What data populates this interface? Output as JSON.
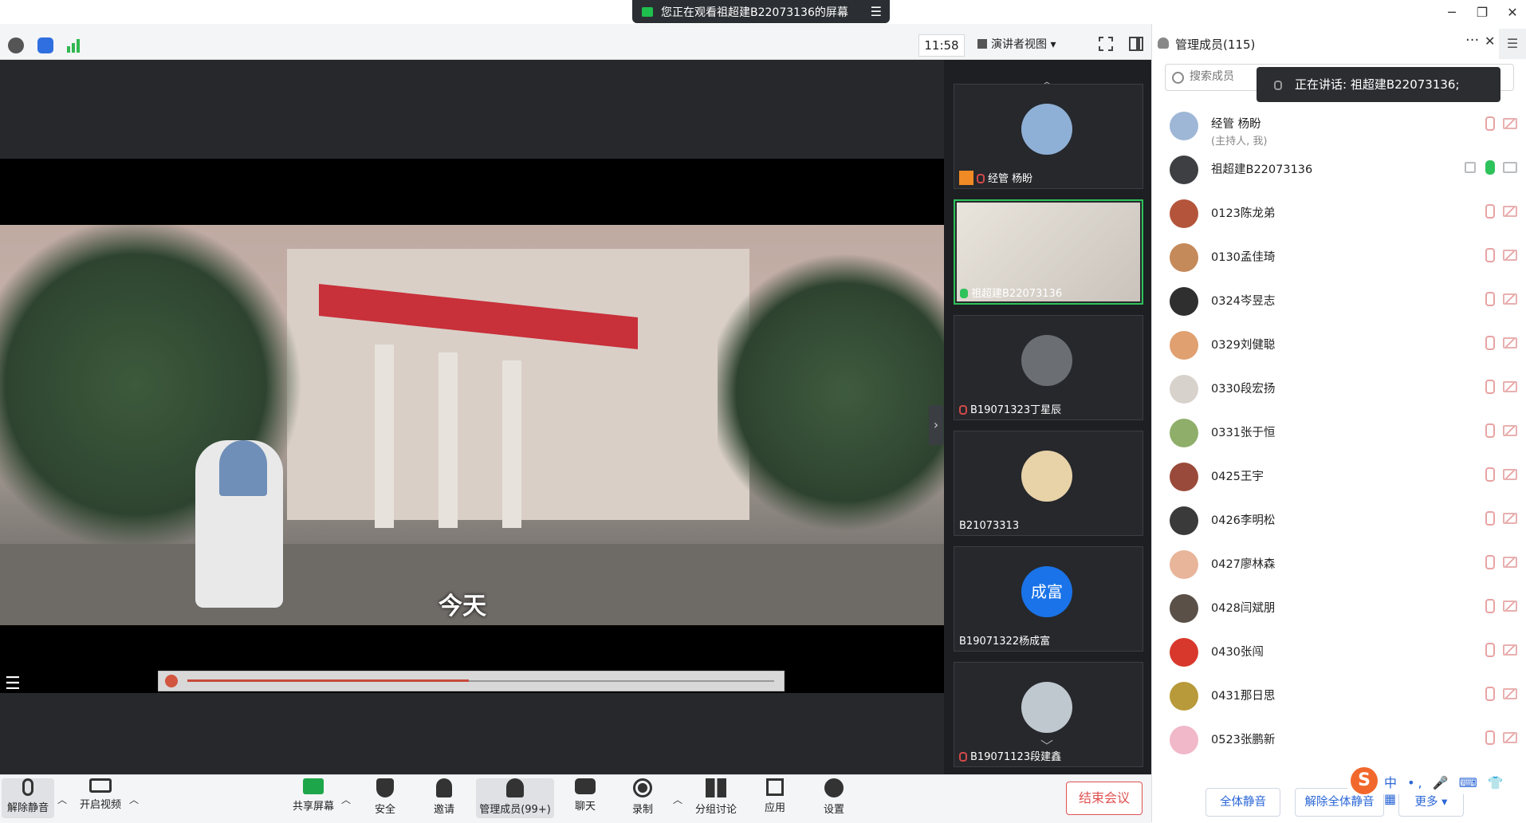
{
  "window": {
    "banner_text": "您正在观看祖超建B22073136的屏幕",
    "minimize": "─",
    "maximize": "❐",
    "close": "✕"
  },
  "toolbar": {
    "clock": "11:58",
    "view_mode": "演讲者视图 ▾",
    "fullscreen_icon": "fullscreen-icon",
    "layout_icon": "layout-icon"
  },
  "video": {
    "subtitle": "今天",
    "playback_progress": 0.48,
    "list_icon": "☰"
  },
  "gallery": {
    "tiles": [
      {
        "name": "经管 杨盼",
        "host": true,
        "mic": "off",
        "avatar_color": "#8fb0d6"
      },
      {
        "name": "祖超建B22073136",
        "host": false,
        "mic": "on",
        "avatar_color": "#d4d4d4",
        "active": true
      },
      {
        "name": "B19071323丁星辰",
        "host": false,
        "mic": "off",
        "avatar_color": "#6b6f73"
      },
      {
        "name": "B21073313",
        "host": false,
        "mic": "none",
        "avatar_color": "#e8d2a8"
      },
      {
        "name": "B19071322杨成富",
        "host": false,
        "mic": "none",
        "avatar_color": "#1a73e8",
        "initials": "成富"
      },
      {
        "name": "B19071123段建鑫",
        "host": false,
        "mic": "off",
        "avatar_color": "#bfc7cf"
      }
    ]
  },
  "bottombar": {
    "unmute": "解除静音",
    "start_video": "开启视频",
    "share_screen": "共享屏幕",
    "security": "安全",
    "invite": "邀请",
    "manage_members": "管理成员(99+)",
    "chat": "聊天",
    "record": "录制",
    "breakout": "分组讨论",
    "apps": "应用",
    "settings": "设置",
    "end_meeting": "结束会议"
  },
  "panel": {
    "title": "管理成员(115)",
    "more": "···",
    "close": "✕",
    "search_placeholder": "搜索成员",
    "speaking_label": "正在讲话: 祖超建B22073136;",
    "members": [
      {
        "name": "经管 杨盼",
        "sub": "(主持人, 我)",
        "avatar_color": "#9fb7d6",
        "state": "muted"
      },
      {
        "name": "祖超建B22073136",
        "sub": "",
        "avatar_color": "#3d3f42",
        "state": "speaking"
      },
      {
        "name": "0123陈龙弟",
        "sub": "",
        "avatar_color": "#b4553b",
        "state": "muted"
      },
      {
        "name": "0130孟佳琦",
        "sub": "",
        "avatar_color": "#c58a5a",
        "state": "muted"
      },
      {
        "name": "0324岑昱志",
        "sub": "",
        "avatar_color": "#2f2f2f",
        "state": "muted"
      },
      {
        "name": "0329刘健聪",
        "sub": "",
        "avatar_color": "#e0a070",
        "state": "muted"
      },
      {
        "name": "0330段宏扬",
        "sub": "",
        "avatar_color": "#d8d2cc",
        "state": "muted"
      },
      {
        "name": "0331张于恒",
        "sub": "",
        "avatar_color": "#8fae6a",
        "state": "muted"
      },
      {
        "name": "0425王宇",
        "sub": "",
        "avatar_color": "#9a4a3a",
        "state": "muted"
      },
      {
        "name": "0426李明松",
        "sub": "",
        "avatar_color": "#3a3a3a",
        "state": "muted"
      },
      {
        "name": "0427廖林森",
        "sub": "",
        "avatar_color": "#e8b59a",
        "state": "muted"
      },
      {
        "name": "0428闫斌朋",
        "sub": "",
        "avatar_color": "#5a5048",
        "state": "muted"
      },
      {
        "name": "0430张闯",
        "sub": "",
        "avatar_color": "#d8382c",
        "state": "muted"
      },
      {
        "name": "0431那日思",
        "sub": "",
        "avatar_color": "#b89a3a",
        "state": "muted"
      },
      {
        "name": "0523张鹏新",
        "sub": "",
        "avatar_color": "#f0b8c8",
        "state": "muted"
      }
    ],
    "mute_all": "全体静音",
    "unmute_all": "解除全体静音",
    "more_button": "更多 ▾"
  },
  "ime": {
    "logo": "S",
    "text": "中 •, 🎤 ⌨ 👕 ▦"
  }
}
